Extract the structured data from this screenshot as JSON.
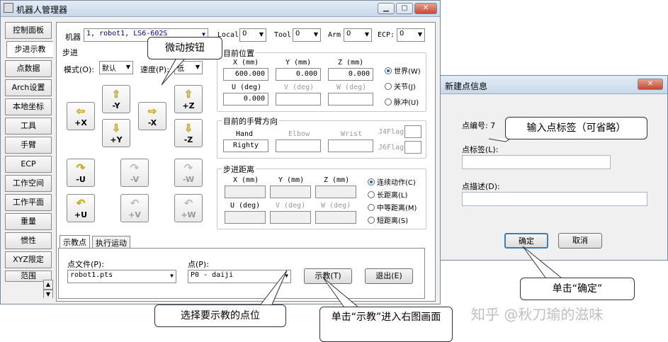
{
  "window": {
    "title": "机器人管理器",
    "min": "▁",
    "max": "▢",
    "close": "✕"
  },
  "sidebar": {
    "items": [
      {
        "label": "控制面板"
      },
      {
        "label": "步进示教"
      },
      {
        "label": "点数据"
      },
      {
        "label": "Arch设置"
      },
      {
        "label": "本地坐标"
      },
      {
        "label": "工具"
      },
      {
        "label": "手臂"
      },
      {
        "label": "ECP"
      },
      {
        "label": "工作空间"
      },
      {
        "label": "工作平面"
      },
      {
        "label": "重量"
      },
      {
        "label": "惯性"
      },
      {
        "label": "XYZ限定"
      },
      {
        "label": "范围"
      }
    ],
    "active": 1
  },
  "top": {
    "robot_label": "机器",
    "robot_value": "1, robot1, LS6-602S",
    "local_label": "Local",
    "local_value": "0",
    "tool_label": "Tool",
    "tool_value": "0",
    "arm_label": "Arm",
    "arm_value": "0",
    "ecp_label": "ECP:",
    "ecp_value": "0"
  },
  "jog": {
    "title": "步进",
    "mode_label": "模式(O):",
    "mode_value": "默认",
    "speed_label": "速度(P):",
    "speed_value": "低",
    "buttons": [
      {
        "label": "-Y"
      },
      {
        "label": "+Z"
      },
      {
        "label": "+X"
      },
      {
        "label": "-X"
      },
      {
        "label": "+Y"
      },
      {
        "label": "-Z"
      },
      {
        "label": "-U"
      },
      {
        "label": "-V"
      },
      {
        "label": "-W"
      },
      {
        "label": "+U"
      },
      {
        "label": "+V"
      },
      {
        "label": "+W"
      }
    ]
  },
  "position": {
    "title": "目前位置",
    "x_label": "X (mm)",
    "y_label": "Y (mm)",
    "z_label": "Z (mm)",
    "x": "600.000",
    "y": "0.000",
    "z": "0.000",
    "u_label": "U (deg)",
    "v_label": "V (deg)",
    "w_label": "W (deg)",
    "u": "0.000",
    "modes": [
      "世界(W)",
      "关节(J)",
      "脉冲(U)"
    ]
  },
  "arm": {
    "title": "目前的手臂方向",
    "hand_label": "Hand",
    "elbow_label": "Elbow",
    "wrist_label": "Wrist",
    "hand_value": "Righty",
    "j4_label": "J4Flag",
    "j6_label": "J6Flag"
  },
  "step": {
    "title": "步进距离",
    "x_label": "X (mm)",
    "y_label": "Y (mm)",
    "z_label": "Z (mm)",
    "u_label": "U (deg)",
    "v_label": "V (deg)",
    "w_label": "W (deg)",
    "options": [
      "连续动作(C)",
      "长距离(L)",
      "中等距离(M)",
      "短距离(S)"
    ]
  },
  "tabs": {
    "teach": "示教点",
    "exec": "执行运动"
  },
  "teach": {
    "file_label": "点文件(P):",
    "file_value": "robot1.pts",
    "point_label": "点(P):",
    "point_value": "P0 - daiji",
    "teach_button": "示教(T)",
    "exit_button": "退出(E)"
  },
  "dialog": {
    "title": "新建点信息",
    "close": "✕",
    "number_label": "点编号: 7",
    "tag_label": "点标签(L):",
    "desc_label": "点描述(D):",
    "ok": "确定",
    "cancel": "取消"
  },
  "callouts": {
    "jog_btn": "微动按钮",
    "tag": "输入点标签（可省略）",
    "select": "选择要示教的点位",
    "teach": "单击“示教”进入右图画面",
    "ok": "单击“确定”"
  },
  "watermark": "知乎 @秋刀瑜的滋味"
}
